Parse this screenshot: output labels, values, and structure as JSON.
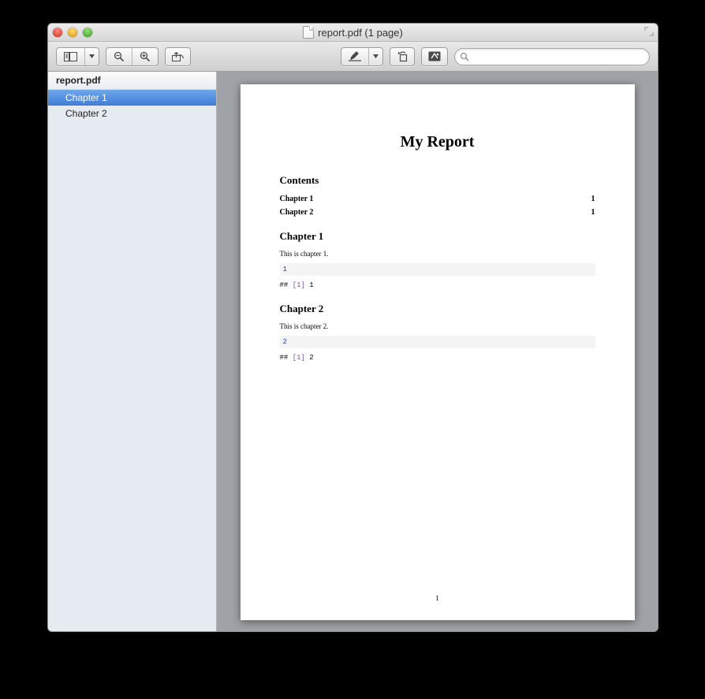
{
  "window": {
    "title": "report.pdf (1 page)"
  },
  "sidebar": {
    "header": "report.pdf",
    "items": [
      {
        "label": "Chapter 1",
        "selected": true
      },
      {
        "label": "Chapter 2",
        "selected": false
      }
    ]
  },
  "search": {
    "placeholder": ""
  },
  "document": {
    "title": "My Report",
    "contents_heading": "Contents",
    "toc": [
      {
        "label": "Chapter 1",
        "page": "1"
      },
      {
        "label": "Chapter 2",
        "page": "1"
      }
    ],
    "chapters": [
      {
        "heading": "Chapter 1",
        "text": "This is chapter 1.",
        "code": "1",
        "output_prefix": "## ",
        "output_bracket": "[1]",
        "output_value": " 1"
      },
      {
        "heading": "Chapter 2",
        "text": "This is chapter 2.",
        "code": "2",
        "output_prefix": "## ",
        "output_bracket": "[1]",
        "output_value": " 2"
      }
    ],
    "page_number": "1"
  }
}
